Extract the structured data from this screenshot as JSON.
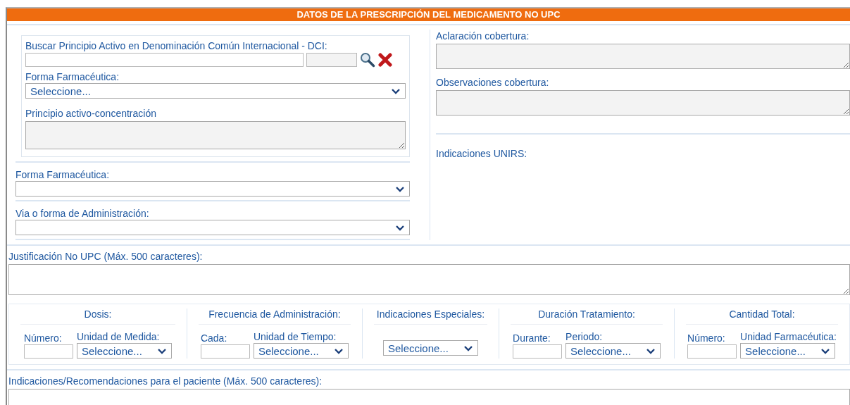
{
  "header": {
    "title": "DATOS DE LA PRESCRIPCIÓN DEL MEDICAMENTO NO UPC"
  },
  "search_box": {
    "label": "Buscar Principio Activo en Denominación Común Internacional - DCI:",
    "form_label": "Forma Farmacéutica:",
    "form_select": {
      "value": "Seleccione..."
    },
    "concentration_label": "Principio activo-concentración",
    "concentration_area": {
      "disabled": true
    }
  },
  "left_fields": [
    {
      "label": "Forma Farmacéutica:"
    },
    {
      "label": "Via o forma de Administración:"
    }
  ],
  "right_fields": [
    {
      "kind": "textarea",
      "label": "Aclaración cobertura:",
      "disabled": true
    },
    {
      "kind": "textarea",
      "label": "Observaciones cobertura:",
      "disabled": true
    },
    {
      "kind": "text",
      "label": "Indicaciones UNIRS:"
    }
  ],
  "justification": {
    "label": "Justificación No UPC (Máx. 500 caracteres):",
    "disabled": false
  },
  "groups": [
    {
      "title": "Dosis:",
      "fields": [
        {
          "kind": "input",
          "label": "Número:"
        },
        {
          "kind": "select",
          "label": "Unidad de Medida:",
          "value": "Seleccione..."
        }
      ]
    },
    {
      "title": "Frecuencia de Administración:",
      "fields": [
        {
          "kind": "input",
          "label": "Cada:"
        },
        {
          "kind": "select",
          "label": "Unidad de Tiempo:",
          "value": "Seleccione..."
        }
      ]
    },
    {
      "title": "Indicaciones Especiales:",
      "fields": [
        {
          "kind": "select",
          "value": "Seleccione..."
        }
      ]
    },
    {
      "title": "Duración Tratamiento:",
      "fields": [
        {
          "kind": "input",
          "label": "Durante:"
        },
        {
          "kind": "select",
          "label": "Periodo:",
          "value": "Seleccione..."
        }
      ]
    },
    {
      "title": "Cantidad Total:",
      "fields": [
        {
          "kind": "input",
          "label": "Número:"
        },
        {
          "kind": "select",
          "label": "Unidad Farmacéutica:",
          "value": "Seleccione..."
        }
      ]
    }
  ],
  "patient_notes": {
    "label": "Indicaciones/Recomendaciones para el paciente (Máx. 500 caracteres):",
    "disabled": false
  }
}
